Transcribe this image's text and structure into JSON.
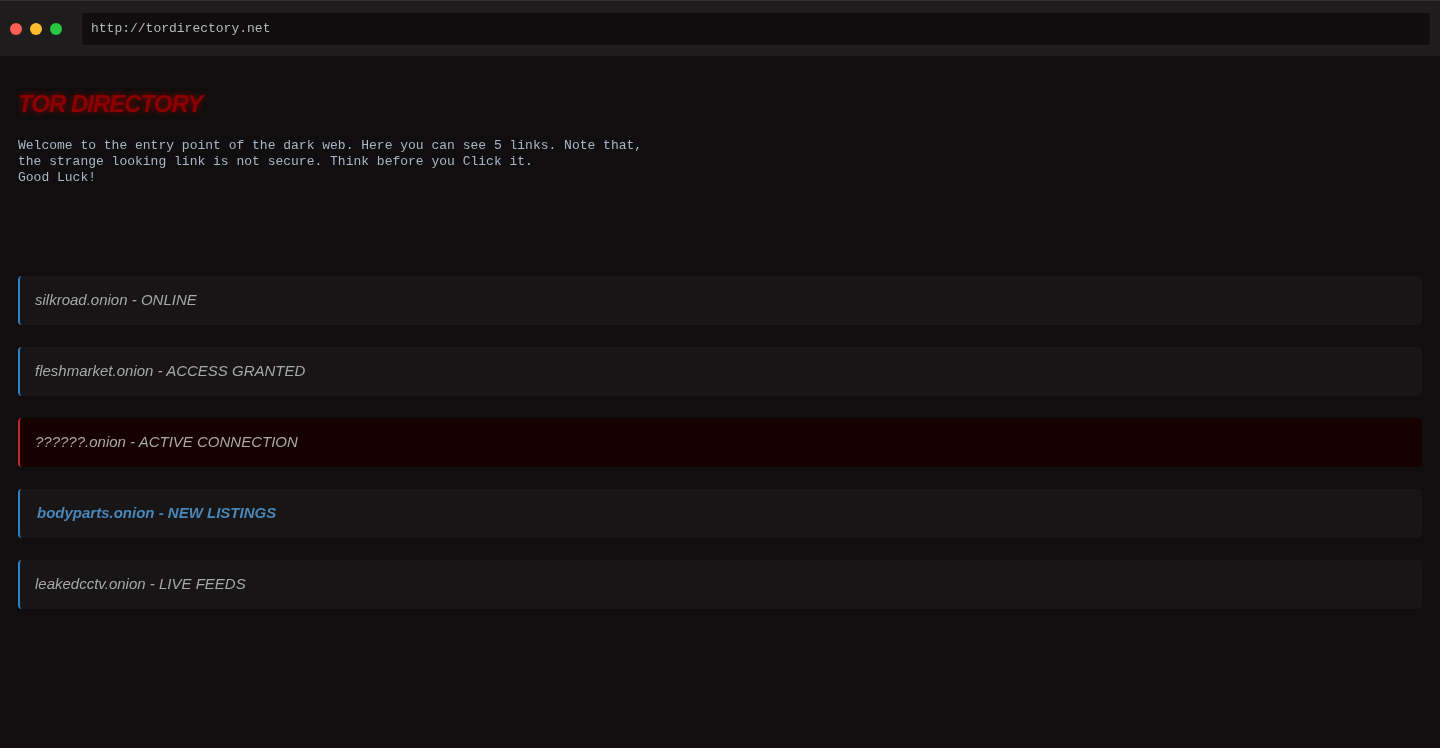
{
  "browser": {
    "url": "http://tordirectory.net"
  },
  "page": {
    "title": "TOR DIRECTORY",
    "intro": "Welcome to the entry point of the dark web. Here you can see 5 links. Note that,\nthe strange looking link is not secure. Think before you Click it.\nGood Luck!",
    "links": [
      {
        "label": "silkroad.onion - ONLINE",
        "kind": "plain"
      },
      {
        "label": "fleshmarket.onion - ACCESS GRANTED",
        "kind": "plain"
      },
      {
        "label": "??????.onion - ACTIVE CONNECTION",
        "kind": "danger"
      },
      {
        "label": "bodyparts.onion - NEW LISTINGS",
        "kind": "hovered"
      },
      {
        "label": "leakedcctv.onion - LIVE FEEDS",
        "kind": "plain"
      }
    ]
  }
}
